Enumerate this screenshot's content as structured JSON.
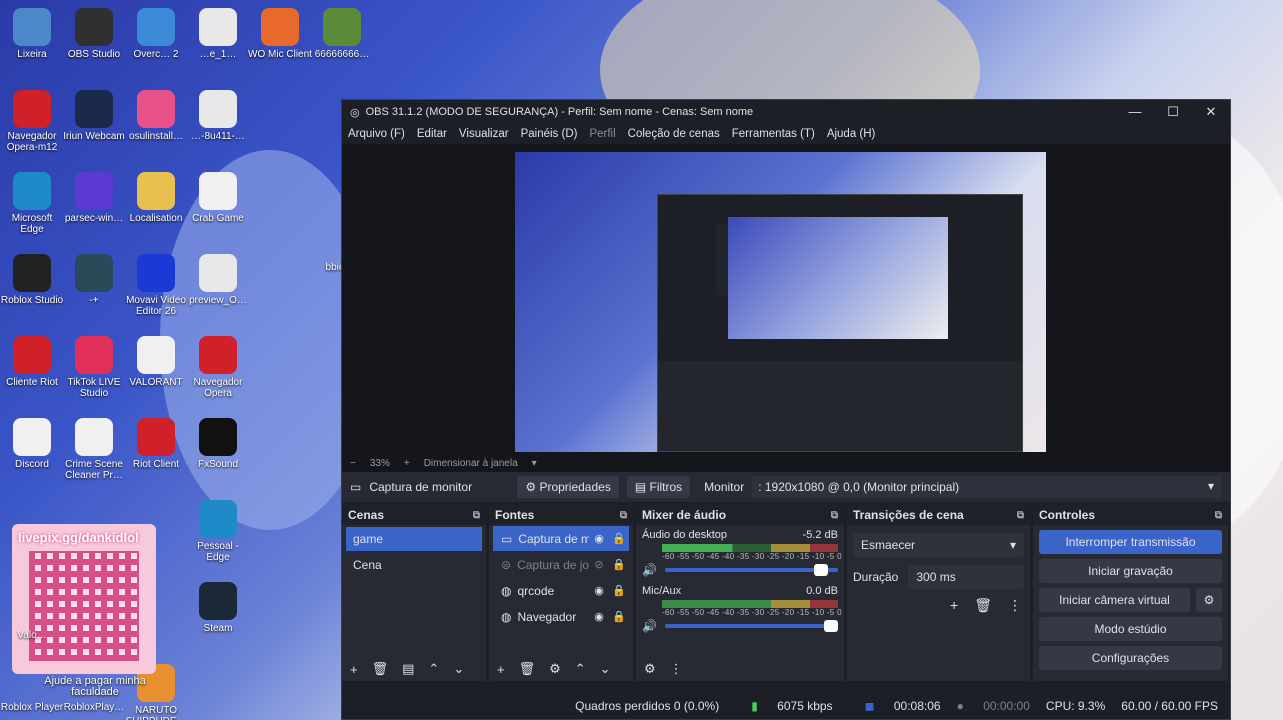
{
  "desktop": {
    "icons": [
      {
        "label": "Lixeira",
        "icon": "recycle-bin-icon",
        "color": "#4a88c9"
      },
      {
        "label": "OBS Studio",
        "icon": "obs-icon",
        "color": "#303030"
      },
      {
        "label": "Overc… 2",
        "icon": "globe-icon",
        "color": "#3a8ad6"
      },
      {
        "label": "…e_1…",
        "icon": "java-icon",
        "color": "#e8e8e8"
      },
      {
        "label": "WO Mic Client",
        "icon": "microphone-icon",
        "color": "#e86a2a"
      },
      {
        "label": "66666666…",
        "icon": "minecraft-icon",
        "color": "#5a8a3a"
      },
      {
        "label": "Navegador Opera-m12",
        "icon": "opera-icon",
        "color": "#d0202a"
      },
      {
        "label": "Iriun Webcam",
        "icon": "webcam-icon",
        "color": "#1c2a4a"
      },
      {
        "label": "osulinstall…",
        "icon": "osu-icon",
        "color": "#e8508a"
      },
      {
        "label": "…-8u411-…",
        "icon": "java-icon",
        "color": "#e8e8e8"
      },
      {
        "label": "Microsoft Edge",
        "icon": "edge-icon",
        "color": "#1f8ac8"
      },
      {
        "label": "parsec-win…",
        "icon": "parsec-icon",
        "color": "#5a3ad0"
      },
      {
        "label": "Localisation",
        "icon": "folder-icon",
        "color": "#e8c050"
      },
      {
        "label": "Crab Game",
        "icon": "file-icon",
        "color": "#f0f0f0"
      },
      {
        "label": "Roblox Studio",
        "icon": "roblox-icon",
        "color": "#222"
      },
      {
        "label": "-+",
        "icon": "league-icon",
        "color": "#2a4a5a"
      },
      {
        "label": "Movavi Video Editor 26",
        "icon": "movavi-icon",
        "color": "#1a3ad8"
      },
      {
        "label": "preview_O…",
        "icon": "java-icon",
        "color": "#e8e8e8"
      },
      {
        "label": "Cliente Riot",
        "icon": "riot-icon",
        "color": "#d0202a"
      },
      {
        "label": "TikTok LIVE Studio",
        "icon": "tiktok-icon",
        "color": "#e0305a"
      },
      {
        "label": "VALORANT",
        "icon": "file-icon",
        "color": "#f0f0f0"
      },
      {
        "label": "Navegador Opera",
        "icon": "opera-icon",
        "color": "#d0202a"
      },
      {
        "label": "Discord",
        "icon": "file-icon",
        "color": "#f0f0f0"
      },
      {
        "label": "Crime Scene Cleaner Pr…",
        "icon": "file-icon",
        "color": "#f0f0f0"
      },
      {
        "label": "Riot Client",
        "icon": "riot-icon",
        "color": "#d0202a"
      },
      {
        "label": "FxSound",
        "icon": "fxsound-icon",
        "color": "#111"
      },
      {
        "label": "Pessoal - Edge",
        "icon": "edge-icon",
        "color": "#1f8ac8"
      },
      {
        "label": "Steam",
        "icon": "steam-icon",
        "color": "#1b2838"
      },
      {
        "label": "NARUTO SHIPPUDE…",
        "icon": "naruto-icon",
        "color": "#e89030"
      }
    ],
    "overlay_url": "livepix.gg/dankidlol",
    "overlay_caption": "Ajude a pagar minha faculdade",
    "roblox_player": "Roblox Player",
    "roblox_player2": "RobloxPlay…",
    "partial_label": "bbie…",
    "partial_label2": "Valo…"
  },
  "obs": {
    "title": "OBS 31.1.2 (MODO DE SEGURANÇA) - Perfil: Sem nome - Cenas: Sem nome",
    "menu": [
      "Arquivo (F)",
      "Editar",
      "Visualizar",
      "Painéis (D)",
      "Perfil",
      "Coleção de cenas",
      "Ferramentas (T)",
      "Ajuda (H)"
    ],
    "zoom": "33%",
    "scale_mode": "Dimensionar à janela",
    "source_name": "Captura de monitor",
    "properties_label": "Propriedades",
    "filters_label": "Filtros",
    "monitor_label": "Monitor",
    "monitor_value": ": 1920x1080 @ 0,0 (Monitor principal)",
    "scenes": {
      "title": "Cenas",
      "items": [
        "game",
        "Cena"
      ]
    },
    "sources": {
      "title": "Fontes",
      "items": [
        {
          "label": "Captura de m",
          "icon": "monitor-icon"
        },
        {
          "label": "Captura de jog",
          "icon": "gamepad-icon"
        },
        {
          "label": "qrcode",
          "icon": "globe-icon"
        },
        {
          "label": "Navegador",
          "icon": "globe-icon"
        }
      ]
    },
    "mixer": {
      "title": "Mixer de áudio",
      "scale": "-60 -55 -50 -45 -40 -35 -30 -25 -20 -15 -10 -5 0",
      "tracks": [
        {
          "name": "Áudio do desktop",
          "db": "-5.2 dB",
          "volume": 0.94
        },
        {
          "name": "Mic/Aux",
          "db": "0.0 dB",
          "volume": 1.0
        }
      ]
    },
    "transitions": {
      "title": "Transições de cena",
      "selected": "Esmaecer",
      "duration_label": "Duração",
      "duration_value": "300 ms"
    },
    "controls": {
      "title": "Controles",
      "buttons": [
        "Interromper transmissão",
        "Iniciar gravação",
        "Iniciar câmera virtual",
        "Modo estúdio",
        "Configurações"
      ]
    },
    "status": {
      "dropped": "Quadros perdidos 0 (0.0%)",
      "bitrate": "6075 kbps",
      "stream_time": "00:08:06",
      "rec_time": "00:00:00",
      "cpu": "CPU: 9.3%",
      "fps": "60.00 / 60.00 FPS"
    }
  }
}
